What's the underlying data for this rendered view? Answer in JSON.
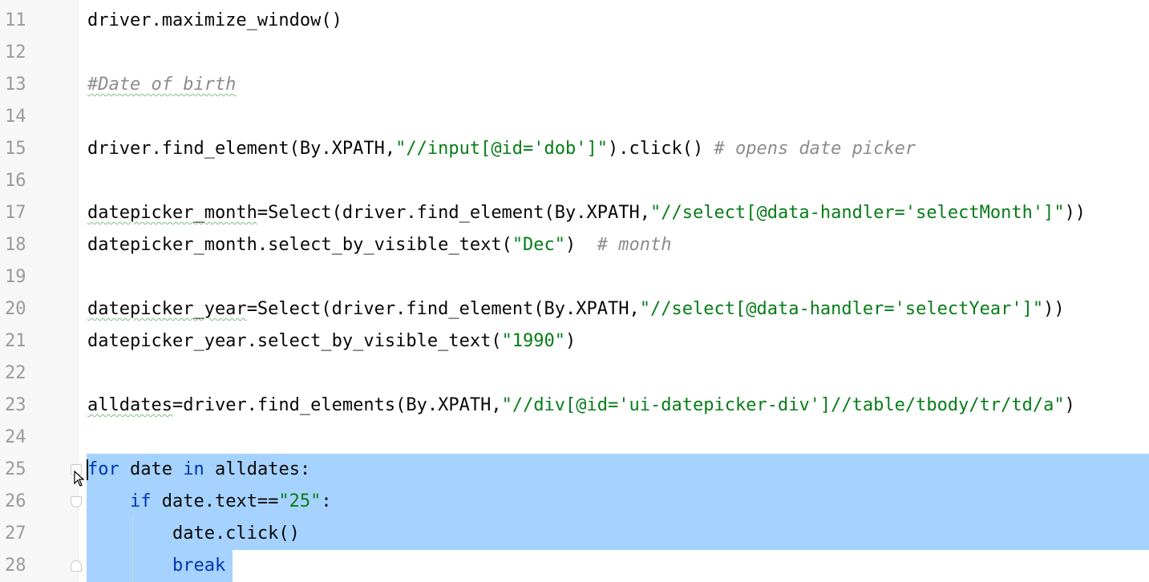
{
  "editor": {
    "lines": [
      {
        "num": "11",
        "parts": [
          {
            "t": "driver.maximize_window()",
            "c": ""
          }
        ]
      },
      {
        "num": "12",
        "parts": []
      },
      {
        "num": "13",
        "parts": [
          {
            "t": "#Date of birth",
            "c": "cmt wavy"
          }
        ]
      },
      {
        "num": "14",
        "parts": []
      },
      {
        "num": "15",
        "parts": [
          {
            "t": "driver.find_element(By.XPATH,",
            "c": ""
          },
          {
            "t": "\"//input[@id='dob']\"",
            "c": "str"
          },
          {
            "t": ").click() ",
            "c": ""
          },
          {
            "t": "# opens date picker",
            "c": "cmt"
          }
        ]
      },
      {
        "num": "16",
        "parts": []
      },
      {
        "num": "17",
        "parts": [
          {
            "t": "datepicker_month",
            "c": "wavy"
          },
          {
            "t": "=Select(driver.find_element(By.XPATH,",
            "c": ""
          },
          {
            "t": "\"//select[@data-handler='selectMonth']\"",
            "c": "str"
          },
          {
            "t": "))",
            "c": ""
          }
        ]
      },
      {
        "num": "18",
        "parts": [
          {
            "t": "datepicker_month.select_by_visible_text(",
            "c": ""
          },
          {
            "t": "\"Dec\"",
            "c": "str"
          },
          {
            "t": ")  ",
            "c": ""
          },
          {
            "t": "# month",
            "c": "cmt"
          }
        ]
      },
      {
        "num": "19",
        "parts": []
      },
      {
        "num": "20",
        "parts": [
          {
            "t": "datepicker_year",
            "c": "wavy"
          },
          {
            "t": "=Select(driver.find_element(By.XPATH,",
            "c": ""
          },
          {
            "t": "\"//select[@data-handler='selectYear']\"",
            "c": "str"
          },
          {
            "t": "))",
            "c": ""
          }
        ]
      },
      {
        "num": "21",
        "parts": [
          {
            "t": "datepicker_year.select_by_visible_text(",
            "c": ""
          },
          {
            "t": "\"1990\"",
            "c": "str"
          },
          {
            "t": ")",
            "c": ""
          }
        ]
      },
      {
        "num": "22",
        "parts": []
      },
      {
        "num": "23",
        "parts": [
          {
            "t": "alldates",
            "c": "wavy"
          },
          {
            "t": "=driver.find_elements(By.XPATH,",
            "c": ""
          },
          {
            "t": "\"//div[@id='ui-datepicker-div']//table/tbody/tr/td/a\"",
            "c": "str"
          },
          {
            "t": ")",
            "c": ""
          }
        ]
      },
      {
        "num": "24",
        "parts": []
      },
      {
        "num": "25",
        "parts": [
          {
            "t": "for",
            "c": "kw"
          },
          {
            "t": " date ",
            "c": ""
          },
          {
            "t": "in",
            "c": "kw"
          },
          {
            "t": " alldates:",
            "c": ""
          }
        ]
      },
      {
        "num": "26",
        "parts": [
          {
            "t": "    ",
            "c": ""
          },
          {
            "t": "if",
            "c": "kw"
          },
          {
            "t": " date.text==",
            "c": ""
          },
          {
            "t": "\"25\"",
            "c": "str"
          },
          {
            "t": ":",
            "c": ""
          }
        ]
      },
      {
        "num": "27",
        "parts": [
          {
            "t": "        date.click()",
            "c": ""
          }
        ]
      },
      {
        "num": "28",
        "parts": [
          {
            "t": "        ",
            "c": ""
          },
          {
            "t": "break",
            "c": "kw"
          }
        ]
      }
    ]
  }
}
